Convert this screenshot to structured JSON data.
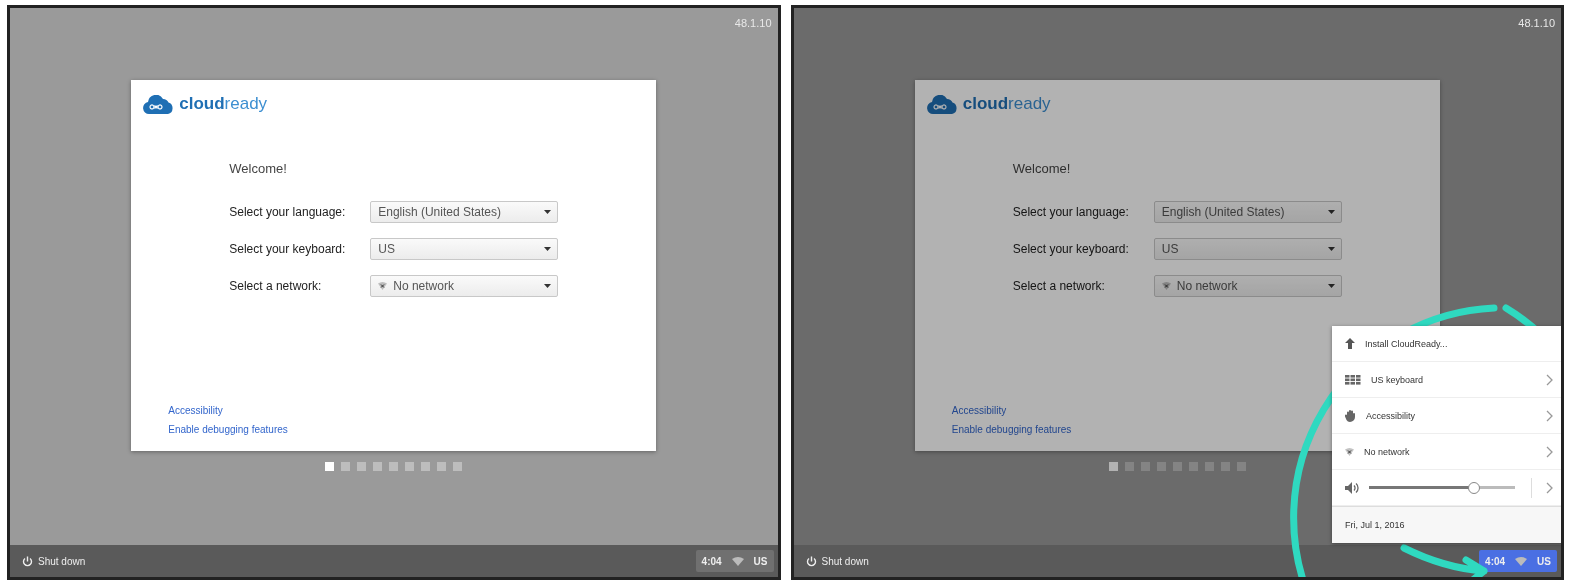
{
  "panels": [
    {
      "dimmed": false,
      "version": "48.1.10",
      "card": {
        "brand": "**cloud**ready",
        "welcome": "Welcome!",
        "fields": [
          {
            "label": "Select your language:",
            "value": "English (United States)",
            "kind": "plain"
          },
          {
            "label": "Select your keyboard:",
            "value": "US",
            "kind": "plain"
          },
          {
            "label": "Select a network:",
            "value": "No network",
            "kind": "network"
          }
        ],
        "links": [
          "Accessibility",
          "Enable debugging features"
        ]
      },
      "dots": [
        {
          "selected": true
        },
        {
          "selected": false
        },
        {
          "selected": false
        },
        {
          "selected": false
        },
        {
          "selected": false
        },
        {
          "selected": false
        },
        {
          "selected": false
        },
        {
          "selected": false
        },
        {
          "selected": false
        }
      ],
      "shelf": {
        "shutdown": "Shut down",
        "time": "4:04",
        "keyboard": "US",
        "tray_selected": false
      },
      "annotation": false
    },
    {
      "dimmed": true,
      "version": "48.1.10",
      "card": {
        "brand": "**cloud**ready",
        "welcome": "Welcome!",
        "fields": [
          {
            "label": "Select your language:",
            "value": "English (United States)",
            "kind": "plain"
          },
          {
            "label": "Select your keyboard:",
            "value": "US",
            "kind": "plain"
          },
          {
            "label": "Select a network:",
            "value": "No network",
            "kind": "network"
          }
        ],
        "links": [
          "Accessibility",
          "Enable debugging features"
        ]
      },
      "dots": [
        {
          "selected": true
        },
        {
          "selected": false
        },
        {
          "selected": false
        },
        {
          "selected": false
        },
        {
          "selected": false
        },
        {
          "selected": false
        },
        {
          "selected": false
        },
        {
          "selected": false
        },
        {
          "selected": false
        }
      ],
      "shelf": {
        "shutdown": "Shut down",
        "time": "4:04",
        "keyboard": "US",
        "tray_selected": true
      },
      "tray_menu": {
        "items": [
          {
            "kind": "install",
            "label": "Install CloudReady..."
          },
          {
            "kind": "keyboard",
            "label": "US keyboard"
          },
          {
            "kind": "accessibility",
            "label": "Accessibility"
          },
          {
            "kind": "network",
            "label": "No network"
          },
          {
            "kind": "volume",
            "level": 0.72
          },
          {
            "kind": "date",
            "label": "Fri, Jul 1, 2016"
          }
        ]
      },
      "annotation": true
    }
  ]
}
